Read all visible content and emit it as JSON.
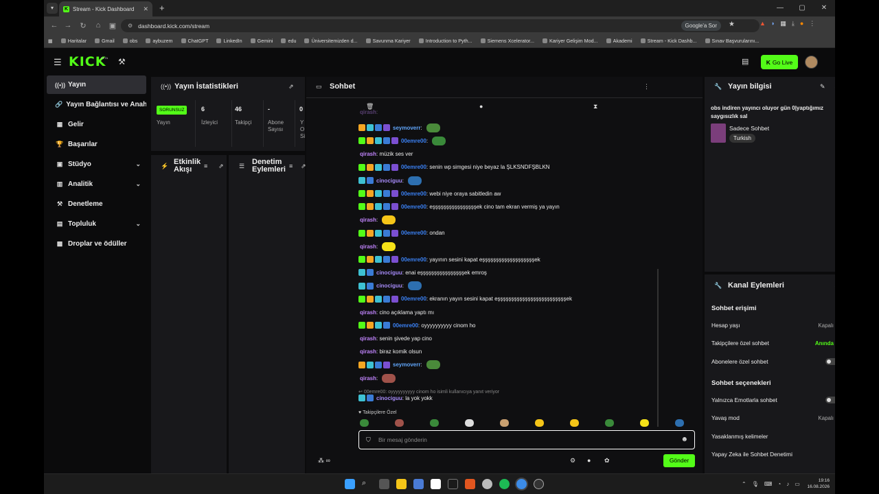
{
  "browser": {
    "tab_title": "Stream - Kick Dashboard",
    "url": "dashboard.kick.com/stream",
    "google_sor": "Google'a Sor",
    "bookmarks": [
      "Haritalar",
      "Gmail",
      "obs",
      "aybuzem",
      "ChatGPT",
      "LinkedIn",
      "Gemini",
      "edu",
      "Üniversitemizden d...",
      "Savunma Kariyer",
      "Introduction to Pyth...",
      "Siemens Xcelerator...",
      "Kariyer Gelişim Mod...",
      "Akademi",
      "Stream - Kick Dashb...",
      "Sınav Başvurularını..."
    ]
  },
  "header": {
    "logo": "KICK",
    "beta": "BETA",
    "go_live": "Go Live"
  },
  "sidebar": {
    "items": [
      {
        "label": "Yayın",
        "icon": "stream-icon"
      },
      {
        "label": "Yayın Bağlantısı ve Anahtar",
        "icon": "link-icon"
      },
      {
        "label": "Gelir",
        "icon": "revenue-icon"
      },
      {
        "label": "Başarılar",
        "icon": "trophy-icon"
      },
      {
        "label": "Stüdyo",
        "icon": "studio-icon"
      },
      {
        "label": "Analitik",
        "icon": "analytics-icon"
      },
      {
        "label": "Denetleme",
        "icon": "moderation-icon"
      },
      {
        "label": "Topluluk",
        "icon": "community-icon"
      },
      {
        "label": "Droplar ve ödüller",
        "icon": "drops-icon"
      }
    ]
  },
  "stats": {
    "title": "Yayın İstatistikleri",
    "badge": "SORUNSUZ",
    "badge_label": "Yayın",
    "cells": [
      {
        "value": "6",
        "label": "İzleyici"
      },
      {
        "value": "46",
        "label": "Takipçi"
      },
      {
        "value": "-",
        "label": "Abone Sayısı"
      },
      {
        "value": "0",
        "label": "Y O Si"
      }
    ]
  },
  "activity": {
    "title": "Etkinlik Akışı"
  },
  "modlog": {
    "title": "Denetim Eylemleri"
  },
  "chat": {
    "title": "Sohbet",
    "messages": [
      {
        "user": "qirash",
        "text": "",
        "cls": "u-q"
      },
      {
        "user": "seymoverr",
        "text": "",
        "cls": "u-s",
        "badges": [
          "bk2",
          "bk3",
          "bk4",
          "bk5"
        ],
        "emote": "#4a8a3a"
      },
      {
        "user": "00emre00",
        "text": "",
        "cls": "u-e",
        "badges": [
          "bk1",
          "bk2",
          "bk3",
          "bk4",
          "bk5"
        ],
        "emote": "#3a8a3a"
      },
      {
        "user": "qirash",
        "text": "müzik ses ver",
        "cls": "u-q"
      },
      {
        "user": "00emre00",
        "text": "senin wp simgesi niye beyaz la ŞLKSNDFŞBLKN",
        "cls": "u-e",
        "badges": [
          "bk1",
          "bk2",
          "bk3",
          "bk4",
          "bk5"
        ]
      },
      {
        "user": "cinociguu",
        "text": "",
        "cls": "u-c",
        "badges": [
          "bk3",
          "bk4"
        ],
        "emote": "#2d6fb0"
      },
      {
        "user": "00emre00",
        "text": "webi niye oraya sabitledin aw",
        "cls": "u-e",
        "badges": [
          "bk1",
          "bk2",
          "bk3",
          "bk4",
          "bk5"
        ]
      },
      {
        "user": "00emre00",
        "text": "eşşşşşşşşşşşşşşşşek cino tam ekran vermiş ya yayın",
        "cls": "u-e",
        "badges": [
          "bk1",
          "bk2",
          "bk3",
          "bk4",
          "bk5"
        ]
      },
      {
        "user": "qirash",
        "text": "",
        "cls": "u-q",
        "emote": "#f5c518"
      },
      {
        "user": "00emre00",
        "text": "ondan",
        "cls": "u-e",
        "badges": [
          "bk1",
          "bk2",
          "bk3",
          "bk4",
          "bk5"
        ]
      },
      {
        "user": "qirash",
        "text": "",
        "cls": "u-q",
        "emote": "#f5e218"
      },
      {
        "user": "00emre00",
        "text": "yayının sesini kapat eşşşşşşşşşşşşşşşşşşşek",
        "cls": "u-e",
        "badges": [
          "bk1",
          "bk2",
          "bk3",
          "bk4",
          "bk5"
        ]
      },
      {
        "user": "cinociguu",
        "text": "enai eşşşşşşşşşşşşşşşşek emroş",
        "cls": "u-c",
        "badges": [
          "bk3",
          "bk4"
        ]
      },
      {
        "user": "cinociguu",
        "text": "",
        "cls": "u-c",
        "badges": [
          "bk3",
          "bk4"
        ],
        "emote": "#2d6fb0"
      },
      {
        "user": "00emre00",
        "text": "ekranın yayın sesini kapat eşşşşşşşşşşşşşşşşşşşşşşşşşek",
        "cls": "u-e",
        "badges": [
          "bk1",
          "bk2",
          "bk3",
          "bk4",
          "bk5"
        ]
      },
      {
        "user": "qirash",
        "text": "cino açıklama yaptı mı",
        "cls": "u-q"
      },
      {
        "user": "00emre00",
        "text": "oyyyyyyyyyy cinom ho",
        "cls": "u-e",
        "badges": [
          "bk1",
          "bk2",
          "bk3",
          "bk4"
        ]
      },
      {
        "user": "qirash",
        "text": "senin şivede yap cino",
        "cls": "u-q"
      },
      {
        "user": "qirash",
        "text": "biraz komik olsun",
        "cls": "u-q"
      },
      {
        "user": "seymoverr",
        "text": "",
        "cls": "u-s",
        "badges": [
          "bk2",
          "bk3",
          "bk4",
          "bk5"
        ],
        "emote": "#4a8a3a"
      },
      {
        "user": "qirash",
        "text": "",
        "cls": "u-q",
        "emote": "#a0524a"
      }
    ],
    "reply_context": "00emre00: oyyyyyyyyyy cinom ho isimli kullanıcıya yanıt veriyor",
    "last_message": {
      "user": "cinociguu",
      "text": "la yok yokk"
    },
    "followers_only": "Takipçilere Özel",
    "input_placeholder": "Bir mesaj gönderin",
    "send_label": "Gönder"
  },
  "stream_info": {
    "title": "Yayın bilgisi",
    "stream_title": "obs indiren yayıncı oluyor gün 0|yaptığımız saygısızlık sal",
    "category": "Sadece Sohbet",
    "language": "Turkish"
  },
  "channel_actions": {
    "title": "Kanal Eylemleri",
    "section1": "Sohbet erişimi",
    "rows1": [
      {
        "label": "Hesap yaşı",
        "value": "Kapalı"
      },
      {
        "label": "Takipçilere özel sohbet",
        "value": "Anında"
      },
      {
        "label": "Abonelere özel sohbet",
        "value": ""
      }
    ],
    "section2": "Sohbet seçenekleri",
    "rows2": [
      {
        "label": "Yalnızca Emotlarla sohbet",
        "value": ""
      },
      {
        "label": "Yavaş mod",
        "value": "Kapalı"
      },
      {
        "label": "Yasaklanmış kelimeler",
        "value": ""
      },
      {
        "label": "Yapay Zeka ile Sohbet Denetimi",
        "value": ""
      }
    ]
  },
  "taskbar": {
    "time": "19:16",
    "date": "16.08.2026"
  },
  "colors": {
    "accent": "#53fc18",
    "panel": "#18181b",
    "bg": "#0b0b0c"
  }
}
